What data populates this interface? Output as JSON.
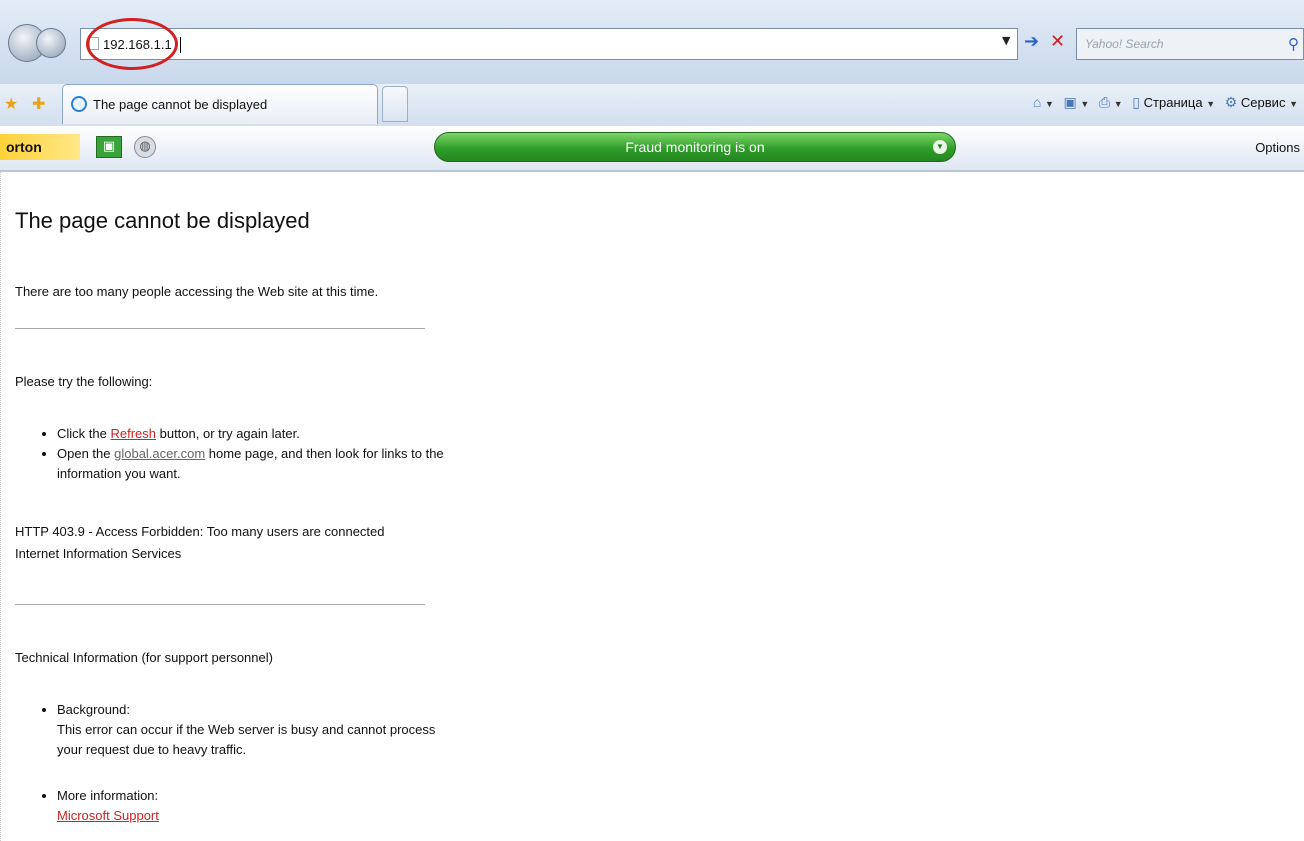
{
  "address_bar": {
    "url": "192.168.1.1",
    "search_placeholder": "Yahoo! Search"
  },
  "tabs": [
    {
      "title": "The page cannot be displayed"
    }
  ],
  "command_bar": {
    "page_label": "Страница",
    "tools_label": "Сервис"
  },
  "norton": {
    "logo_text": "orton",
    "fraud_status": "Fraud monitoring is on",
    "options_label": "Options"
  },
  "page": {
    "title": "The page cannot be displayed",
    "intro": "There are too many people accessing the Web site at this time.",
    "try_heading": "Please try the following:",
    "bullet1_prefix": "Click the ",
    "bullet1_link": "Refresh",
    "bullet1_suffix": " button, or try again later.",
    "bullet2_prefix": "Open the ",
    "bullet2_link": "global.acer.com",
    "bullet2_suffix": " home page, and then look for links to the information you want.",
    "error_line1": "HTTP 403.9 - Access Forbidden: Too many users are connected",
    "error_line2": "Internet Information Services",
    "tech_heading": "Technical Information (for support personnel)",
    "background_label": "Background:",
    "background_text": "This error can occur if the Web server is busy and cannot process your request due to heavy traffic.",
    "more_info_label": "More information:",
    "more_info_link": "Microsoft Support"
  }
}
